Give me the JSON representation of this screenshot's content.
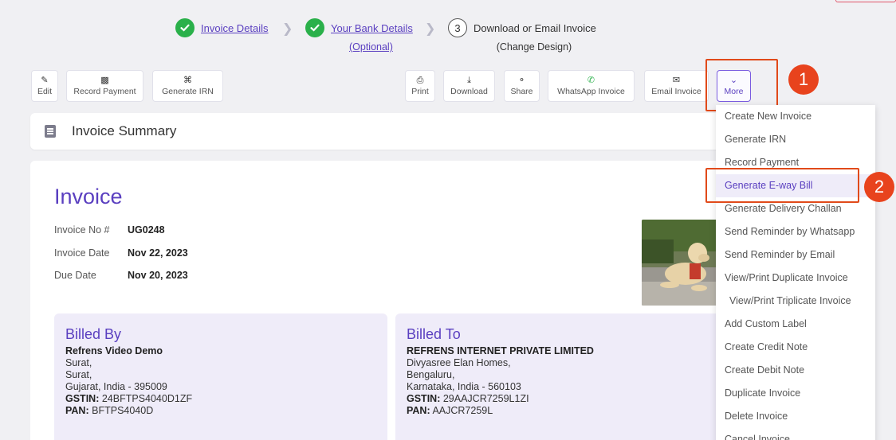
{
  "stepper": {
    "step1": {
      "label": "Invoice Details"
    },
    "step2": {
      "label": "Your Bank Details",
      "sub": "(Optional)"
    },
    "step3": {
      "number": "3",
      "label": "Download or Email Invoice",
      "sub": "(Change Design)"
    }
  },
  "toolbar": {
    "edit": "Edit",
    "record_payment": "Record Payment",
    "generate_irn": "Generate IRN",
    "print": "Print",
    "download": "Download",
    "share": "Share",
    "whatsapp": "WhatsApp Invoice",
    "email": "Email Invoice",
    "more": "More"
  },
  "annotations": {
    "badge1": "1",
    "badge2": "2",
    "color": "#e8431d"
  },
  "summary": {
    "title": "Invoice Summary"
  },
  "invoice": {
    "title": "Invoice",
    "number_label": "Invoice No #",
    "number": "UG0248",
    "date_label": "Invoice Date",
    "date": "Nov 22, 2023",
    "due_label": "Due Date",
    "due": "Nov 20, 2023"
  },
  "billed_by": {
    "heading": "Billed By",
    "name": "Refrens Video Demo",
    "line1": "Surat,",
    "line2": "Surat,",
    "line3": "Gujarat, India - 395009",
    "gstin_label": "GSTIN:",
    "gstin": "24BFTPS4040D1ZF",
    "pan_label": "PAN:",
    "pan": "BFTPS4040D"
  },
  "billed_to": {
    "heading": "Billed To",
    "name": "REFRENS INTERNET PRIVATE LIMITED",
    "line1": "Divyasree Elan Homes,",
    "line2": "Bengaluru,",
    "line3": "Karnataka, India - 560103",
    "gstin_label": "GSTIN:",
    "gstin": "29AAJCR7259L1ZI",
    "pan_label": "PAN:",
    "pan": "AAJCR7259L"
  },
  "menu": {
    "items": [
      "Create New Invoice",
      "Generate IRN",
      "Record Payment",
      "Generate E-way Bill",
      "Generate Delivery Challan",
      "Send Reminder by Whatsapp",
      "Send Reminder by Email",
      "View/Print Duplicate Invoice",
      " View/Print Triplicate Invoice",
      "Add Custom Label",
      "Create Credit Note",
      "Create Debit Note",
      "Duplicate Invoice",
      "Delete Invoice",
      "Cancel Invoice"
    ],
    "active_index": 3
  },
  "colors": {
    "brand": "#5a3fc0",
    "success": "#2ab04a",
    "highlight": "#e14a1a"
  }
}
